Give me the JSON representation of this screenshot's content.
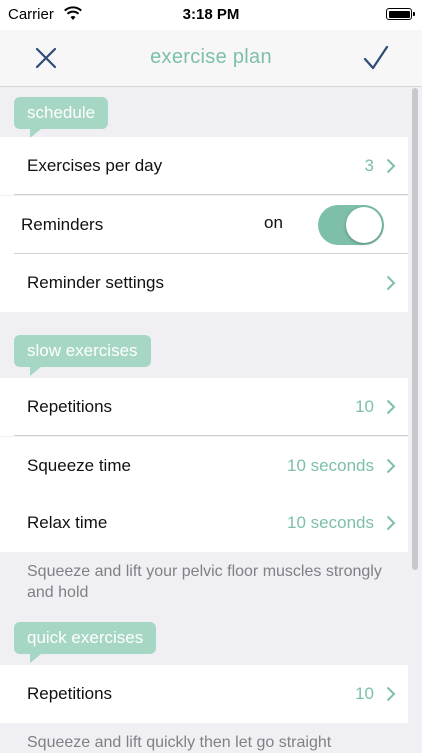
{
  "status_bar": {
    "carrier": "Carrier",
    "time": "3:18 PM"
  },
  "nav": {
    "title": "exercise plan",
    "close_icon": "close-icon",
    "done_icon": "checkmark-icon"
  },
  "sections": {
    "schedule": {
      "tag": "schedule",
      "exercises_per_day": {
        "label": "Exercises per day",
        "value": "3"
      },
      "reminders": {
        "label": "Reminders",
        "state": "on",
        "enabled": true
      },
      "reminder_settings": {
        "label": "Reminder settings"
      }
    },
    "slow": {
      "tag": "slow exercises",
      "repetitions": {
        "label": "Repetitions",
        "value": "10"
      },
      "squeeze_time": {
        "label": "Squeeze time",
        "value": "10 seconds"
      },
      "relax_time": {
        "label": "Relax time",
        "value": "10 seconds"
      },
      "footnote": "Squeeze and lift your pelvic floor muscles strongly and hold"
    },
    "quick": {
      "tag": "quick exercises",
      "repetitions": {
        "label": "Repetitions",
        "value": "10"
      },
      "footnote": "Squeeze and lift quickly then let go straight"
    }
  },
  "colors": {
    "accent": "#7dbfa9",
    "tag_background": "#a6d6c4",
    "background": "#efeff4"
  }
}
